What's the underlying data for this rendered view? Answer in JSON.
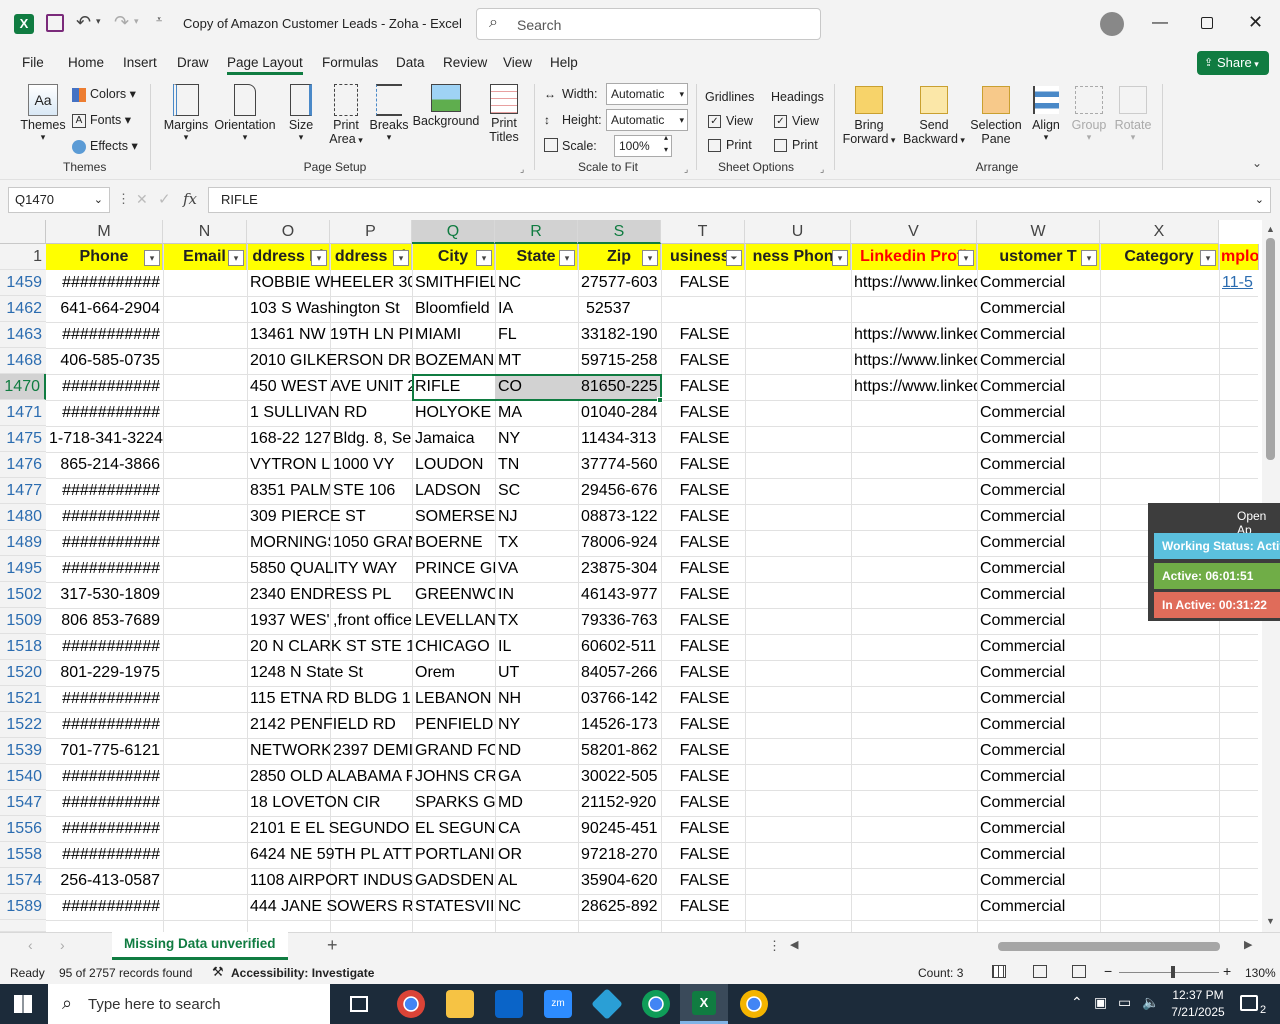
{
  "title": {
    "app_icon": "excel-icon",
    "doc_title": "Copy of Amazon Customer Leads - Zoha - Excel",
    "search_placeholder": "Search"
  },
  "menu": {
    "tabs": [
      "File",
      "Home",
      "Insert",
      "Draw",
      "Page Layout",
      "Formulas",
      "Data",
      "Review",
      "View",
      "Help"
    ],
    "active": "Page Layout",
    "share_label": "Share"
  },
  "ribbon": {
    "themes": {
      "themes": "Themes",
      "colors": "Colors",
      "fonts": "Fonts",
      "effects": "Effects",
      "group": "Themes"
    },
    "page_setup": {
      "margins": "Margins",
      "orientation": "Orientation",
      "size": "Size",
      "print_area_1": "Print",
      "print_area_2": "Area",
      "breaks": "Breaks",
      "background": "Background",
      "print_titles_1": "Print",
      "print_titles_2": "Titles",
      "group": "Page Setup"
    },
    "scale": {
      "width_label": "Width:",
      "width_value": "Automatic",
      "height_label": "Height:",
      "height_value": "Automatic",
      "scale_label": "Scale:",
      "scale_value": "100%",
      "group": "Scale to Fit"
    },
    "sheet_options": {
      "gridlines": "Gridlines",
      "headings": "Headings",
      "view": "View",
      "print": "Print",
      "group": "Sheet Options"
    },
    "arrange": {
      "bring_1": "Bring",
      "bring_2": "Forward",
      "send_1": "Send",
      "send_2": "Backward",
      "selection_1": "Selection",
      "selection_2": "Pane",
      "align": "Align",
      "group_btn": "Group",
      "rotate": "Rotate",
      "group": "Arrange"
    }
  },
  "formula_bar": {
    "name_box": "Q1470",
    "fx": "fx",
    "value": "RIFLE"
  },
  "columns": [
    "M",
    "N",
    "O",
    "P",
    "Q",
    "R",
    "S",
    "T",
    "U",
    "V",
    "W",
    "X"
  ],
  "headers": [
    "Phone",
    "Email",
    "ddress Li",
    "ddress Li",
    "City",
    "State",
    "Zip",
    "usiness-",
    "ness Phone",
    "Linkedin Profi",
    "ustomer T",
    "Category",
    "mplo"
  ],
  "header_row_num": "1",
  "rows": [
    {
      "n": "1459",
      "phone": "###########",
      "o": "ROBBIE WHEELER 30",
      "p": "",
      "city": "SMITHFIEL",
      "state": "NC",
      "zip": "27577-603",
      "t": "FALSE",
      "v": "https://www.linked",
      "w": "Commercial",
      "y": "11-5"
    },
    {
      "n": "1462",
      "phone": "641-664-2904",
      "o": "103 S Washington St",
      "p": "",
      "city": "Bloomfield",
      "state": "IA",
      "zip": "52537",
      "t": "",
      "v": "",
      "w": "Commercial",
      "y": ""
    },
    {
      "n": "1463",
      "phone": "###########",
      "o": "13461 NW 19TH LN PF",
      "p": "",
      "city": "MIAMI",
      "state": "FL",
      "zip": "33182-190",
      "t": "FALSE",
      "v": "https://www.linked",
      "w": "Commercial",
      "y": ""
    },
    {
      "n": "1468",
      "phone": "406-585-0735",
      "o": "2010 GILKERSON DR",
      "p": "",
      "city": "BOZEMAN",
      "state": "MT",
      "zip": "59715-258",
      "t": "FALSE",
      "v": "https://www.linked",
      "w": "Commercial",
      "y": ""
    },
    {
      "n": "1470",
      "phone": "###########",
      "o": "450 WEST AVE UNIT 2",
      "p": "",
      "city": "RIFLE",
      "state": "CO",
      "zip": "81650-225",
      "t": "FALSE",
      "v": "https://www.linked",
      "w": "Commercial",
      "y": ""
    },
    {
      "n": "1471",
      "phone": "###########",
      "o": "1 SULLIVAN RD",
      "p": "",
      "city": "HOLYOKE",
      "state": "MA",
      "zip": "01040-284",
      "t": "FALSE",
      "v": "",
      "w": "Commercial",
      "y": ""
    },
    {
      "n": "1475",
      "phone": "1-718-341-3224",
      "o": "168-22 127",
      "p": "Bldg. 8, Se",
      "city": "Jamaica",
      "state": "NY",
      "zip": "11434-313",
      "t": "FALSE",
      "v": "",
      "w": "Commercial",
      "y": ""
    },
    {
      "n": "1476",
      "phone": "865-214-3866",
      "o": "VYTRON LLC",
      "p": "1000 VY",
      "city": "LOUDON",
      "state": "TN",
      "zip": "37774-560",
      "t": "FALSE",
      "v": "",
      "w": "Commercial",
      "y": ""
    },
    {
      "n": "1477",
      "phone": "###########",
      "o": "8351 PALM",
      "p": "STE 106",
      "city": "LADSON",
      "state": "SC",
      "zip": "29456-676",
      "t": "FALSE",
      "v": "",
      "w": "Commercial",
      "y": ""
    },
    {
      "n": "1480",
      "phone": "###########",
      "o": "309 PIERCE ST",
      "p": "",
      "city": "SOMERSE",
      "state": "NJ",
      "zip": "08873-122",
      "t": "FALSE",
      "v": "",
      "w": "Commercial",
      "y": ""
    },
    {
      "n": "1489",
      "phone": "###########",
      "o": "MORNINGS",
      "p": "1050 GRAN",
      "city": "BOERNE",
      "state": "TX",
      "zip": "78006-924",
      "t": "FALSE",
      "v": "",
      "w": "Commercial",
      "y": ""
    },
    {
      "n": "1495",
      "phone": "###########",
      "o": "5850 QUALITY WAY",
      "p": "",
      "city": "PRINCE GE",
      "state": "VA",
      "zip": "23875-304",
      "t": "FALSE",
      "v": "",
      "w": "Commercial",
      "y": ""
    },
    {
      "n": "1502",
      "phone": "317-530-1809",
      "o": "2340 ENDRESS PL",
      "p": "",
      "city": "GREENWC",
      "state": "IN",
      "zip": "46143-977",
      "t": "FALSE",
      "v": "",
      "w": "Commercial",
      "y": ""
    },
    {
      "n": "1509",
      "phone": "806 853-7689",
      "o": "1937 WES'",
      "p": ",front office",
      "city": "LEVELLAN",
      "state": "TX",
      "zip": "79336-763",
      "t": "FALSE",
      "v": "",
      "w": "Commercial",
      "y": ""
    },
    {
      "n": "1518",
      "phone": "###########",
      "o": "20 N CLARK ST STE 1",
      "p": "",
      "city": "CHICAGO",
      "state": "IL",
      "zip": "60602-511",
      "t": "FALSE",
      "v": "",
      "w": "Commercial",
      "y": ""
    },
    {
      "n": "1520",
      "phone": "801-229-1975",
      "o": "1248 N State St",
      "p": "",
      "city": "Orem",
      "state": "UT",
      "zip": "84057-266",
      "t": "FALSE",
      "v": "",
      "w": "Commercial",
      "y": ""
    },
    {
      "n": "1521",
      "phone": "###########",
      "o": "115 ETNA RD BLDG 1",
      "p": "",
      "city": "LEBANON",
      "state": "NH",
      "zip": "03766-142",
      "t": "FALSE",
      "v": "",
      "w": "Commercial",
      "y": ""
    },
    {
      "n": "1522",
      "phone": "###########",
      "o": "2142 PENFIELD RD",
      "p": "",
      "city": "PENFIELD",
      "state": "NY",
      "zip": "14526-173",
      "t": "FALSE",
      "v": "",
      "w": "Commercial",
      "y": ""
    },
    {
      "n": "1539",
      "phone": "701-775-6121",
      "o": "NETWORK",
      "p": "2397 DEMI",
      "city": "GRAND FC",
      "state": "ND",
      "zip": "58201-862",
      "t": "FALSE",
      "v": "",
      "w": "Commercial",
      "y": ""
    },
    {
      "n": "1540",
      "phone": "###########",
      "o": "2850 OLD ALABAMA F",
      "p": "",
      "city": "JOHNS CR",
      "state": "GA",
      "zip": "30022-505",
      "t": "FALSE",
      "v": "",
      "w": "Commercial",
      "y": ""
    },
    {
      "n": "1547",
      "phone": "###########",
      "o": "18 LOVETON CIR",
      "p": "",
      "city": "SPARKS G",
      "state": "MD",
      "zip": "21152-920",
      "t": "FALSE",
      "v": "",
      "w": "Commercial",
      "y": ""
    },
    {
      "n": "1556",
      "phone": "###########",
      "o": "2101 E EL SEGUNDO",
      "p": "",
      "city": "EL SEGUN",
      "state": "CA",
      "zip": "90245-451",
      "t": "FALSE",
      "v": "",
      "w": "Commercial",
      "y": ""
    },
    {
      "n": "1558",
      "phone": "###########",
      "o": "6424 NE 59TH PL ATT",
      "p": "",
      "city": "PORTLANI",
      "state": "OR",
      "zip": "97218-270",
      "t": "FALSE",
      "v": "",
      "w": "Commercial",
      "y": ""
    },
    {
      "n": "1574",
      "phone": "256-413-0587",
      "o": "1108 AIRPORT INDUS",
      "p": "",
      "city": "GADSDEN",
      "state": "AL",
      "zip": "35904-620",
      "t": "FALSE",
      "v": "",
      "w": "Commercial",
      "y": ""
    },
    {
      "n": "1589",
      "phone": "###########",
      "o": "444 JANE SOWERS R",
      "p": "",
      "city": "STATESVII",
      "state": "NC",
      "zip": "28625-892",
      "t": "FALSE",
      "v": "",
      "w": "Commercial",
      "y": ""
    }
  ],
  "overlay": {
    "open": "Open Ap",
    "working": "Working Status: Activ",
    "active": "Active: 06:01:51",
    "inactive": "In Active: 00:31:22"
  },
  "sheet_tab": "Missing Data unverified",
  "status": {
    "ready": "Ready",
    "records": "95 of 2757 records found",
    "accessibility": "Accessibility: Investigate",
    "count": "Count: 3",
    "zoom": "130%"
  },
  "taskbar": {
    "search_placeholder": "Type here to search",
    "time": "12:37 PM",
    "date": "7/21/2025",
    "notif_count": "2"
  },
  "colors": {
    "excel_green": "#107c41",
    "header_yellow": "#ffff00",
    "linkedin_red": "#ff0000",
    "active_green": "#70ad47",
    "inactive_red": "#e06c5a",
    "working_blue": "#5bc0de"
  }
}
